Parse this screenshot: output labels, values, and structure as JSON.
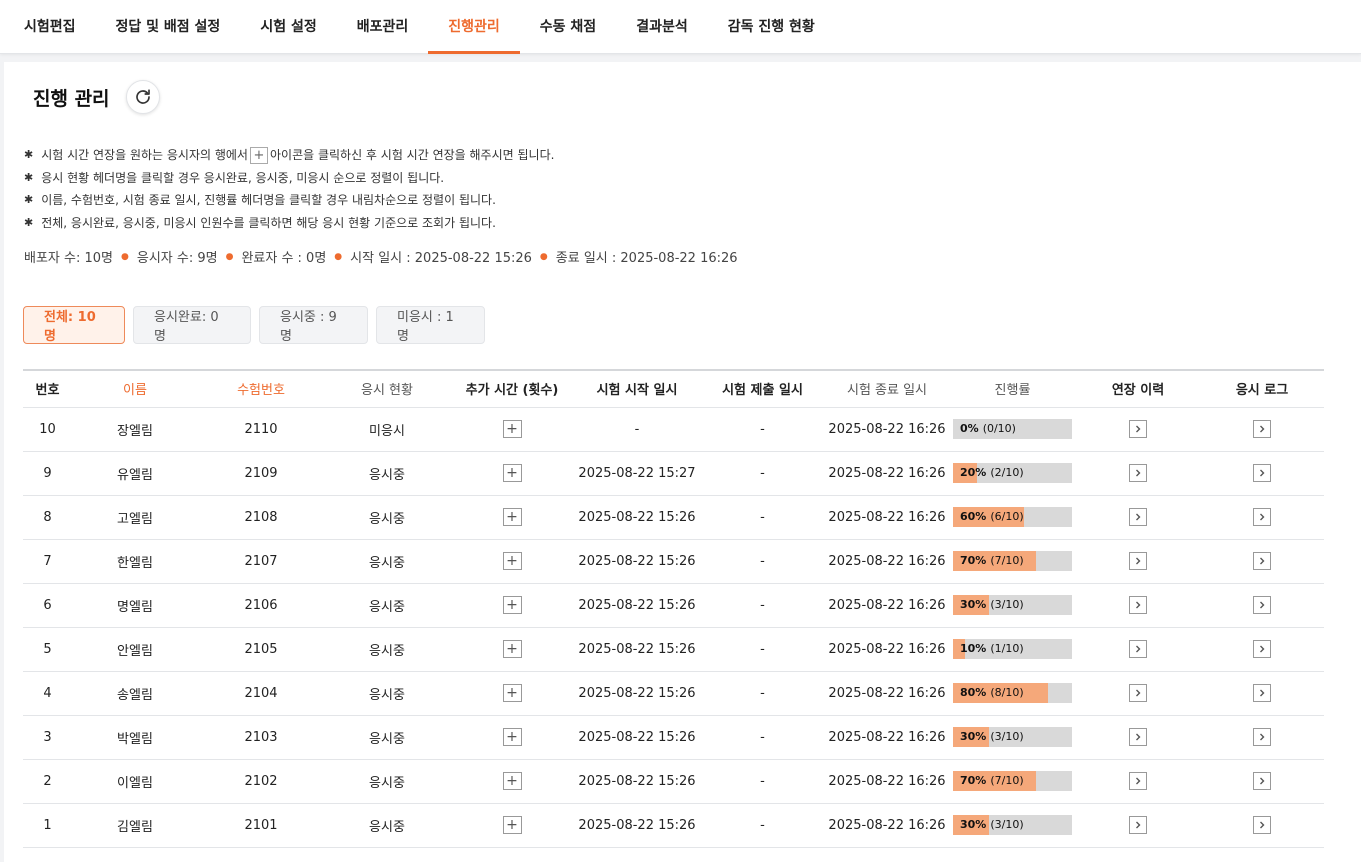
{
  "nav": {
    "tabs": [
      {
        "label": "시험편집"
      },
      {
        "label": "정답 및 배점 설정"
      },
      {
        "label": "시험 설정"
      },
      {
        "label": "배포관리"
      },
      {
        "label": "진행관리",
        "active": true
      },
      {
        "label": "수동 채점"
      },
      {
        "label": "결과분석"
      },
      {
        "label": "감독 진행 현황"
      }
    ]
  },
  "page": {
    "title": "진행 관리",
    "notes": {
      "n1_before": "시험 시간 연장을 원하는 응시자의 행에서",
      "n1_after": "아이콘을 클릭하신 후 시험 시간 연장을 해주시면 됩니다.",
      "n2": "응시 현황 헤더명을 클릭할 경우 응시완료, 응시중, 미응시 순으로 정렬이 됩니다.",
      "n3": "이름, 수험번호, 시험 종료 일시, 진행률 헤더명을 클릭할 경우 내림차순으로 정렬이 됩니다.",
      "n4": "전체, 응시완료, 응시중, 미응시 인원수를 클릭하면 해당 응시 현황 기준으로 조회가 됩니다."
    },
    "stats": {
      "deployed": "배포자 수: 10명",
      "examinees": "응시자 수: 9명",
      "completed": "완료자 수 : 0명",
      "start": "시작 일시 : 2025-08-22 15:26",
      "end": "종료 일시 : 2025-08-22 16:26"
    }
  },
  "filters": {
    "all": "전체: 10명",
    "completed": "응시완료: 0명",
    "in_progress": "응시중 : 9명",
    "not_taken": "미응시 : 1명"
  },
  "table": {
    "headers": {
      "no": "번호",
      "name": "이름",
      "exam_no": "수험번호",
      "status": "응시 현황",
      "extra_time": "추가 시간 (횟수)",
      "start": "시험 시작 일시",
      "submit": "시험 제출 일시",
      "end": "시험 종료 일시",
      "progress": "진행률",
      "ext_history": "연장 이력",
      "log": "응시 로그"
    },
    "rows": [
      {
        "no": "10",
        "name": "장엘림",
        "exam_no": "2110",
        "status": "미응시",
        "start": "-",
        "submit": "-",
        "end": "2025-08-22 16:26",
        "pct": "0%",
        "count": "(0/10)",
        "fraction": 0.0
      },
      {
        "no": "9",
        "name": "유엘림",
        "exam_no": "2109",
        "status": "응시중",
        "start": "2025-08-22 15:27",
        "submit": "-",
        "end": "2025-08-22 16:26",
        "pct": "20%",
        "count": "(2/10)",
        "fraction": 0.2
      },
      {
        "no": "8",
        "name": "고엘림",
        "exam_no": "2108",
        "status": "응시중",
        "start": "2025-08-22 15:26",
        "submit": "-",
        "end": "2025-08-22 16:26",
        "pct": "60%",
        "count": "(6/10)",
        "fraction": 0.6
      },
      {
        "no": "7",
        "name": "한엘림",
        "exam_no": "2107",
        "status": "응시중",
        "start": "2025-08-22 15:26",
        "submit": "-",
        "end": "2025-08-22 16:26",
        "pct": "70%",
        "count": "(7/10)",
        "fraction": 0.7
      },
      {
        "no": "6",
        "name": "명엘림",
        "exam_no": "2106",
        "status": "응시중",
        "start": "2025-08-22 15:26",
        "submit": "-",
        "end": "2025-08-22 16:26",
        "pct": "30%",
        "count": "(3/10)",
        "fraction": 0.3
      },
      {
        "no": "5",
        "name": "안엘림",
        "exam_no": "2105",
        "status": "응시중",
        "start": "2025-08-22 15:26",
        "submit": "-",
        "end": "2025-08-22 16:26",
        "pct": "10%",
        "count": "(1/10)",
        "fraction": 0.1
      },
      {
        "no": "4",
        "name": "송엘림",
        "exam_no": "2104",
        "status": "응시중",
        "start": "2025-08-22 15:26",
        "submit": "-",
        "end": "2025-08-22 16:26",
        "pct": "80%",
        "count": "(8/10)",
        "fraction": 0.8
      },
      {
        "no": "3",
        "name": "박엘림",
        "exam_no": "2103",
        "status": "응시중",
        "start": "2025-08-22 15:26",
        "submit": "-",
        "end": "2025-08-22 16:26",
        "pct": "30%",
        "count": "(3/10)",
        "fraction": 0.3
      },
      {
        "no": "2",
        "name": "이엘림",
        "exam_no": "2102",
        "status": "응시중",
        "start": "2025-08-22 15:26",
        "submit": "-",
        "end": "2025-08-22 16:26",
        "pct": "70%",
        "count": "(7/10)",
        "fraction": 0.7
      },
      {
        "no": "1",
        "name": "김엘림",
        "exam_no": "2101",
        "status": "응시중",
        "start": "2025-08-22 15:26",
        "submit": "-",
        "end": "2025-08-22 16:26",
        "pct": "30%",
        "count": "(3/10)",
        "fraction": 0.3
      }
    ]
  },
  "colors": {
    "accent": "#ee6b2f",
    "progress_fill": "#f5a87a",
    "progress_track": "#d9d9d9"
  }
}
